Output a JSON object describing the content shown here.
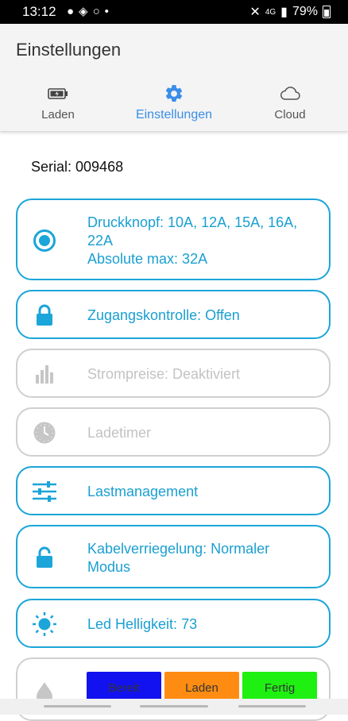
{
  "status": {
    "time": "13:12",
    "network": "4G",
    "battery": "79%"
  },
  "app": {
    "title": "Einstellungen"
  },
  "tabs": [
    {
      "label": "Laden",
      "icon": "battery-charging-icon"
    },
    {
      "label": "Einstellungen",
      "icon": "gear-icon"
    },
    {
      "label": "Cloud",
      "icon": "cloud-icon"
    }
  ],
  "serial": "Serial: 009468",
  "settings": [
    {
      "lines": [
        "Druckknopf: 10A, 12A, 15A, 16A,",
        "22A",
        "Absolute max: 32A"
      ],
      "icon": "radio-button-icon",
      "enabled": true
    },
    {
      "lines": [
        "Zugangskontrolle: Offen"
      ],
      "icon": "lock-icon",
      "enabled": true
    },
    {
      "lines": [
        "Strompreise: Deaktiviert"
      ],
      "icon": "bar-chart-icon",
      "enabled": false
    },
    {
      "lines": [
        "Ladetimer"
      ],
      "icon": "clock-icon",
      "enabled": false
    },
    {
      "lines": [
        "Lastmanagement"
      ],
      "icon": "sliders-icon",
      "enabled": true
    },
    {
      "lines": [
        "Kabelverriegelung: Normaler",
        "Modus"
      ],
      "icon": "unlock-icon",
      "enabled": true
    },
    {
      "lines": [
        "Led Helligkeit: 73"
      ],
      "icon": "sun-icon",
      "enabled": true
    }
  ],
  "led_colors": {
    "icon": "drop-icon",
    "items": [
      {
        "label": "Bereit",
        "color": "#1212f0"
      },
      {
        "label": "Laden",
        "color": "#ff8c12"
      },
      {
        "label": "Fertig",
        "color": "#1ef012"
      }
    ]
  },
  "colors": {
    "accent": "#1ba5d8",
    "tab_active": "#3a8ee8",
    "disabled": "#c3c3c3"
  }
}
